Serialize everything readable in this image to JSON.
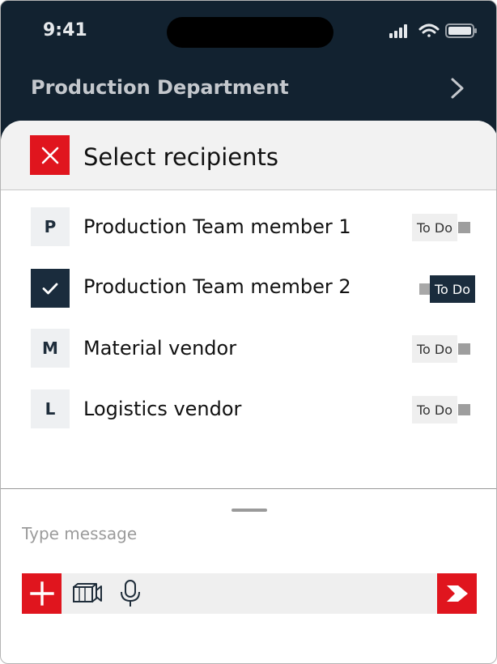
{
  "status_bar": {
    "time": "9:41",
    "icons": [
      "signal-icon",
      "wifi-icon",
      "battery-icon"
    ]
  },
  "header": {
    "title": "Production Department",
    "chevron_icon": "chevron-right-icon"
  },
  "sheet": {
    "title": "Select recipients",
    "close_icon": "close-icon",
    "accent_color": "#e0151e",
    "dark_color": "#1a2c3d"
  },
  "recipients": [
    {
      "initial": "P",
      "name": "Production Team member 1",
      "selected": false,
      "todo_label": "To Do",
      "todo_on": false
    },
    {
      "initial": "",
      "name": "Production Team member 2",
      "selected": true,
      "todo_label": "To Do",
      "todo_on": true
    },
    {
      "initial": "M",
      "name": "Material vendor",
      "selected": false,
      "todo_label": "To Do",
      "todo_on": false
    },
    {
      "initial": "L",
      "name": "Logistics vendor",
      "selected": false,
      "todo_label": "To Do",
      "todo_on": false
    }
  ],
  "composer": {
    "placeholder": "Type message",
    "add_icon": "plus-icon",
    "video_icon": "video-camera-icon",
    "mic_icon": "microphone-icon",
    "send_icon": "send-icon"
  }
}
